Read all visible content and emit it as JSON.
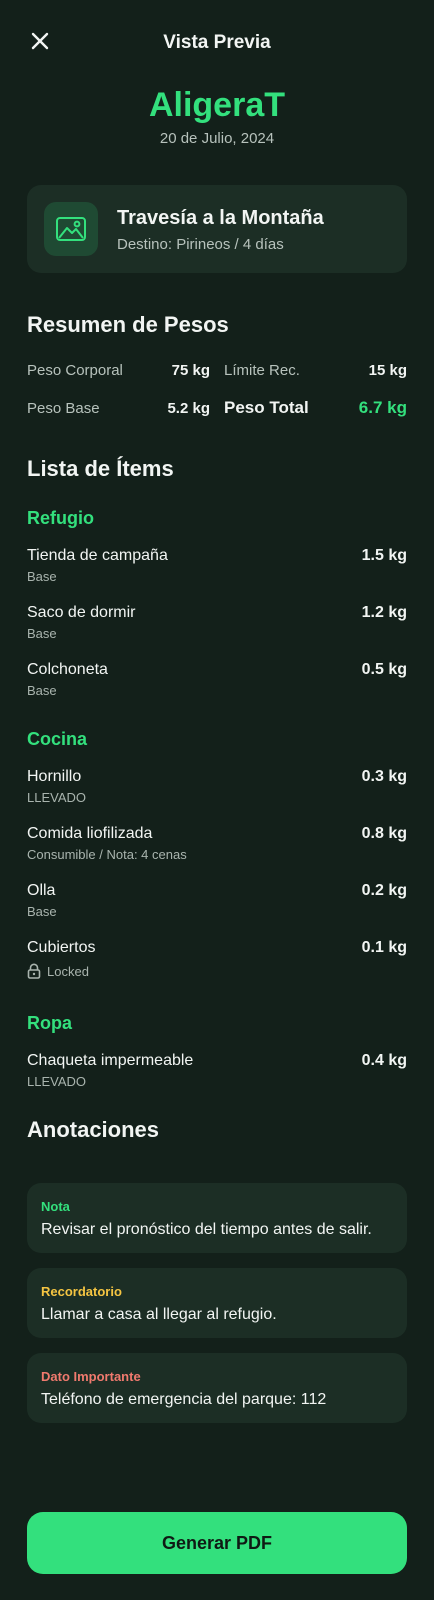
{
  "header": {
    "title": "Vista Previa"
  },
  "app": {
    "name": "AligeraT",
    "date": "20 de Julio, 2024"
  },
  "trip": {
    "title": "Travesía a la Montaña",
    "subtitle": "Destino: Pirineos / 4 días"
  },
  "weights": {
    "section_title": "Resumen de Pesos",
    "body_label": "Peso Corporal",
    "body_value": "75 kg",
    "limit_label": "Límite Rec.",
    "limit_value": "15 kg",
    "base_label": "Peso Base",
    "base_value": "5.2 kg",
    "total_label": "Peso Total",
    "total_value": "6.7 kg"
  },
  "items": {
    "section_title": "Lista de Ítems",
    "categories": [
      {
        "name": "Refugio",
        "items": [
          {
            "name": "Tienda de campaña",
            "sub": "Base",
            "weight": "1.5 kg"
          },
          {
            "name": "Saco de dormir",
            "sub": "Base",
            "weight": "1.2 kg"
          },
          {
            "name": "Colchoneta",
            "sub": "Base",
            "weight": "0.5 kg"
          }
        ]
      },
      {
        "name": "Cocina",
        "items": [
          {
            "name": "Hornillo",
            "sub": "LLEVADO",
            "weight": "0.3 kg"
          },
          {
            "name": "Comida liofilizada",
            "sub": "Consumible / Nota: 4 cenas",
            "weight": "0.8 kg"
          },
          {
            "name": "Olla",
            "sub": "Base",
            "weight": "0.2 kg"
          },
          {
            "name": "Cubiertos",
            "sub": "Locked",
            "weight": "0.1 kg"
          }
        ]
      },
      {
        "name": "Ropa",
        "items": [
          {
            "name": "Chaqueta impermeable",
            "sub": "LLEVADO",
            "weight": "0.4 kg"
          }
        ]
      }
    ]
  },
  "annotations": {
    "section_title": "Anotaciones",
    "notes": [
      {
        "label": "Nota",
        "text": "Revisar el pronóstico del tiempo antes de salir.",
        "color": "#33e07d"
      },
      {
        "label": "Recordatorio",
        "text": "Llamar a casa al llegar al refugio.",
        "color": "#f5c542"
      },
      {
        "label": "Dato Importante",
        "text": "Teléfono de emergencia del parque: 112",
        "color": "#f07a6e"
      }
    ]
  },
  "footer": {
    "button_label": "Generar PDF"
  },
  "icons": {
    "close": "close-icon",
    "trip": "mountain-icon",
    "lock": "lock-icon"
  },
  "colors": {
    "accent": "#33e07d",
    "background": "#13201a",
    "card": "#1c2e25"
  }
}
